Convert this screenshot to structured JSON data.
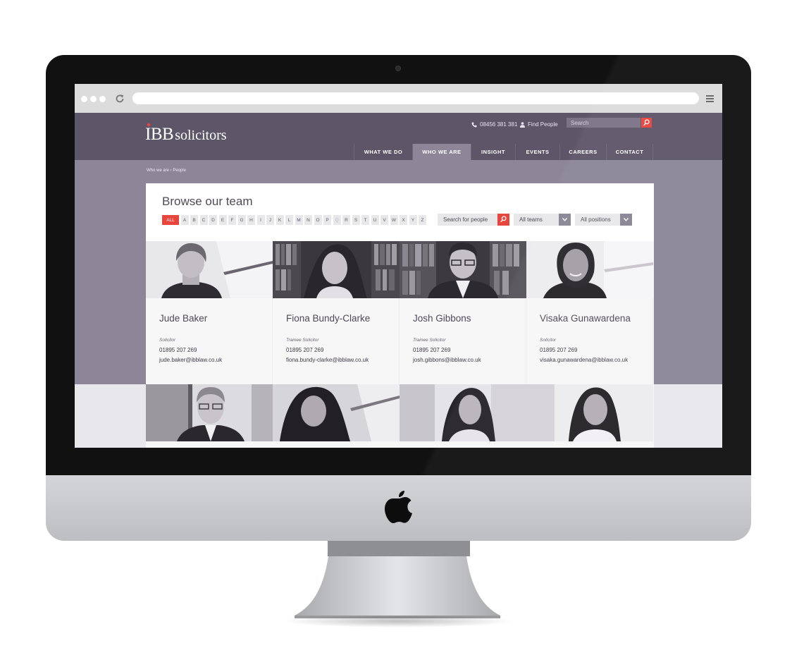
{
  "browser": {
    "address": ""
  },
  "site": {
    "logo_ibb": "IBB",
    "logo_solicitors": "solicitors",
    "phone": "08456 381 381",
    "find_people": "Find People",
    "search_placeholder": "Search",
    "nav": [
      {
        "label": "WHAT WE DO",
        "active": false
      },
      {
        "label": "WHO WE ARE",
        "active": true
      },
      {
        "label": "INSIGHT",
        "active": false
      },
      {
        "label": "EVENTS",
        "active": false
      },
      {
        "label": "CAREERS",
        "active": false
      },
      {
        "label": "CONTACT",
        "active": false
      }
    ],
    "breadcrumb": "Who we are  ›  People"
  },
  "browse": {
    "title": "Browse our team",
    "letters": [
      "ALL",
      "A",
      "B",
      "C",
      "D",
      "E",
      "F",
      "G",
      "H",
      "I",
      "J",
      "K",
      "L",
      "M",
      "N",
      "O",
      "P",
      "Q",
      "R",
      "S",
      "T",
      "U",
      "V",
      "W",
      "X",
      "Y",
      "Z"
    ],
    "search_placeholder": "Search for people",
    "teams_selected": "All teams",
    "positions_selected": "All positions"
  },
  "people": [
    {
      "name": "Jude Baker",
      "role": "Solicitor",
      "phone": "01895 207 269",
      "email": "jude.baker@ibblaw.co.uk"
    },
    {
      "name": "Fiona Bundy-Clarke",
      "role": "Trainee Solicitor",
      "phone": "01895 207 269",
      "email": "fiona.bundy-clarke@ibblaw.co.uk"
    },
    {
      "name": "Josh Gibbons",
      "role": "Trainee Solicitor",
      "phone": "01895 207 269",
      "email": "josh.gibbons@ibblaw.co.uk"
    },
    {
      "name": "Visaka Gunawardena",
      "role": "Solicitor",
      "phone": "01895 207 269",
      "email": "visaka.gunawardena@ibblaw.co.uk"
    }
  ],
  "colors": {
    "header": "#5d5669",
    "accent": "#e8453c",
    "content_bg": "#8c8698"
  }
}
